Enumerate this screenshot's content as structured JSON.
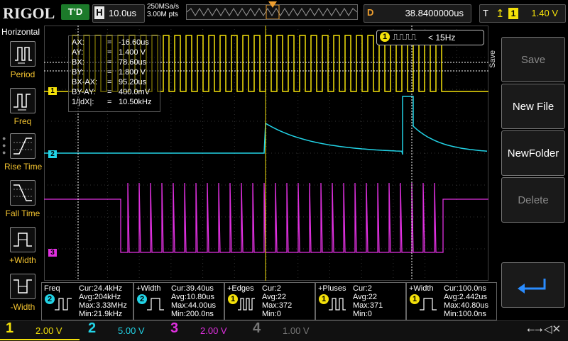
{
  "topbar": {
    "logo": "RIGOL",
    "trigger_status": "T'D",
    "horizontal_label": "H",
    "timebase": "10.0us",
    "sample_rate": "250MSa/s",
    "memory_depth": "3.00M pts",
    "delay_label": "D",
    "delay_value": "38.8400000us",
    "trigger_label": "T",
    "trigger_edge_icon": "rising-edge-icon",
    "trigger_source": "1",
    "trigger_level": "1.40 V"
  },
  "left_menu": {
    "title": "Horizontal",
    "items": [
      {
        "label": "Period",
        "icon": "period-measure-icon"
      },
      {
        "label": "Freq",
        "icon": "freq-measure-icon"
      },
      {
        "label": "Rise Time",
        "icon": "rise-time-icon"
      },
      {
        "label": "Fall Time",
        "icon": "fall-time-icon"
      },
      {
        "label": "+Width",
        "icon": "positive-width-icon"
      },
      {
        "label": "-Width",
        "icon": "negative-width-icon"
      }
    ]
  },
  "cursor_readout": {
    "rows": [
      {
        "key": "AX:",
        "value": "-16.60us"
      },
      {
        "key": "AY:",
        "value": "1.400 V"
      },
      {
        "key": "BX:",
        "value": "78.60us"
      },
      {
        "key": "BY:",
        "value": "1.800 V"
      },
      {
        "key": "BX-AX:",
        "value": "95.20us"
      },
      {
        "key": "BY-AY:",
        "value": "400.0mV"
      },
      {
        "key": "1/|dX|:",
        "value": "10.50kHz"
      }
    ],
    "equals": "="
  },
  "freq_counter": {
    "channel": "1",
    "value": "< 15Hz"
  },
  "channel_markers": [
    "1",
    "2",
    "3"
  ],
  "right_menu": {
    "title": "Save",
    "buttons": [
      "Save",
      "New File",
      "NewFolder",
      "Delete"
    ]
  },
  "measurements": [
    {
      "title": "Freq",
      "channel": "2",
      "color": "#22d3e6",
      "cur": "Cur:24.4kHz",
      "avg": "Avg:204kHz",
      "max": "Max:3.33MHz",
      "min": "Min:21.9kHz",
      "icon": "freq-measure-icon"
    },
    {
      "title": "+Width",
      "channel": "2",
      "color": "#22d3e6",
      "cur": "Cur:39.40us",
      "avg": "Avg:10.80us",
      "max": "Max:44.00us",
      "min": "Min:200.0ns",
      "icon": "positive-width-icon"
    },
    {
      "title": "+Edges",
      "channel": "1",
      "color": "#f4e10a",
      "cur": "Cur:2",
      "avg": "Avg:22",
      "max": "Max:372",
      "min": "Min:0",
      "icon": "rising-edges-count-icon"
    },
    {
      "title": "+Pluses",
      "channel": "1",
      "color": "#f4e10a",
      "cur": "Cur:2",
      "avg": "Avg:22",
      "max": "Max:371",
      "min": "Min:0",
      "icon": "positive-pulses-count-icon"
    },
    {
      "title": "+Width",
      "channel": "1",
      "color": "#f4e10a",
      "cur": "Cur:100.0ns",
      "avg": "Avg:2.442us",
      "max": "Max:40.80us",
      "min": "Min:100.0ns",
      "icon": "positive-width-icon"
    }
  ],
  "channels": [
    {
      "num": "1",
      "scale": "2.00 V",
      "color": "#f4e10a"
    },
    {
      "num": "2",
      "scale": "5.00 V",
      "color": "#22d3e6"
    },
    {
      "num": "3",
      "scale": "2.00 V",
      "color": "#e030e0"
    },
    {
      "num": "4",
      "scale": "1.00 V",
      "color": "#777777"
    }
  ],
  "colors": {
    "ch1": "#f4e10a",
    "ch2": "#22d3e6",
    "ch3": "#e030e0",
    "accent_orange": "#f0a030",
    "trigger_green": "#1c7a2a"
  }
}
